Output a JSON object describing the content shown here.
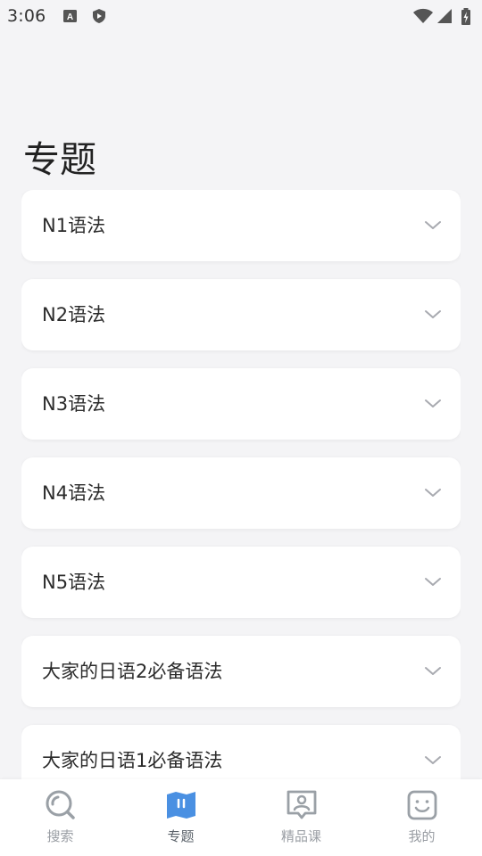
{
  "status_bar": {
    "time": "3:06"
  },
  "page": {
    "title": "专题"
  },
  "topics": [
    {
      "label": "N1语法"
    },
    {
      "label": "N2语法"
    },
    {
      "label": "N3语法"
    },
    {
      "label": "N4语法"
    },
    {
      "label": "N5语法"
    },
    {
      "label": "大家的日语2必备语法"
    },
    {
      "label": "大家的日语1必备语法"
    }
  ],
  "bottom_nav": {
    "items": [
      {
        "label": "搜索",
        "icon": "search-icon",
        "active": false
      },
      {
        "label": "专题",
        "icon": "book-map-icon",
        "active": true
      },
      {
        "label": "精品课",
        "icon": "teacher-board-icon",
        "active": false
      },
      {
        "label": "我的",
        "icon": "smiley-face-icon",
        "active": false
      }
    ]
  },
  "colors": {
    "background": "#f4f4f6",
    "card": "#ffffff",
    "accent": "#4a90e2",
    "nav_inactive": "#9a9ea4",
    "icon_gray": "#9aa0a6"
  }
}
